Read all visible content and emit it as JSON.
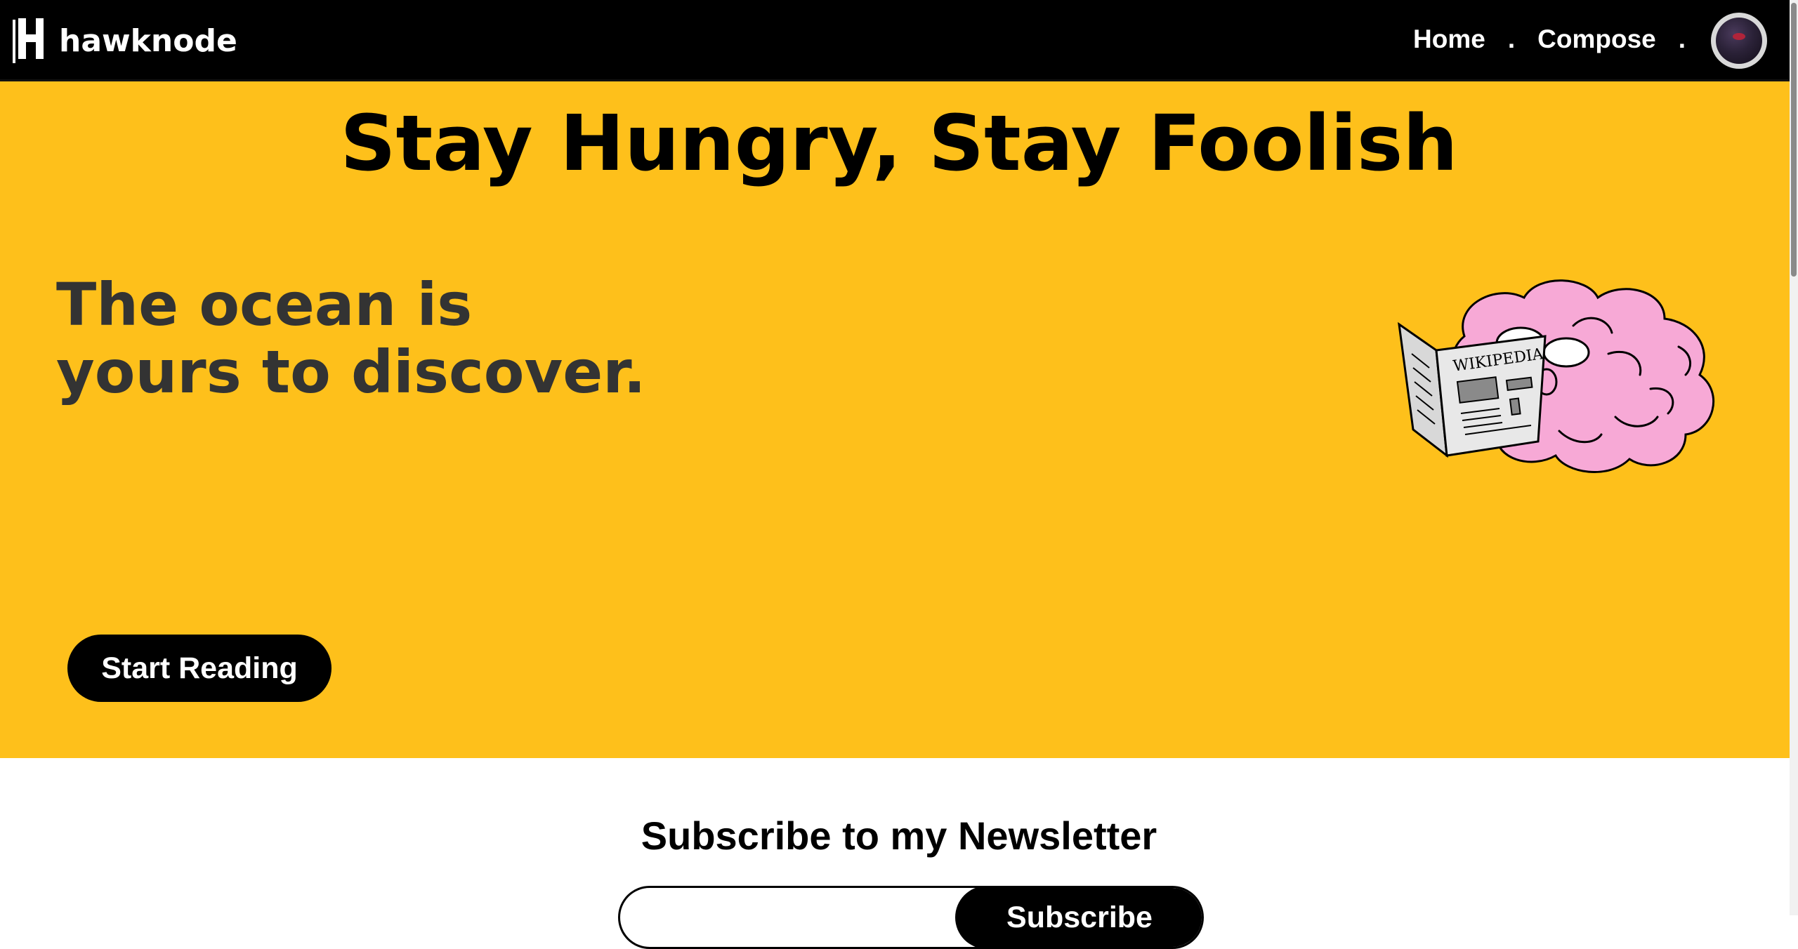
{
  "nav": {
    "brand": "hawknode",
    "links": [
      {
        "label": "Home"
      },
      {
        "label": "Compose"
      }
    ],
    "separator": "."
  },
  "hero": {
    "title": "Stay Hungry, Stay Foolish",
    "tagline_line1": "The ocean is",
    "tagline_line2": "yours to discover.",
    "cta_label": "Start Reading",
    "background_color": "#fec01b",
    "illustration_text": "WIKIPEDIA"
  },
  "newsletter": {
    "title": "Subscribe to my Newsletter",
    "email_value": "",
    "button_label": "Subscribe"
  },
  "colors": {
    "accent": "#fec01b",
    "nav_bg": "#000000",
    "text_dark": "#333333"
  },
  "icons": [
    "brand-logo-icon",
    "user-avatar",
    "brain-reading-newspaper-illustration"
  ]
}
